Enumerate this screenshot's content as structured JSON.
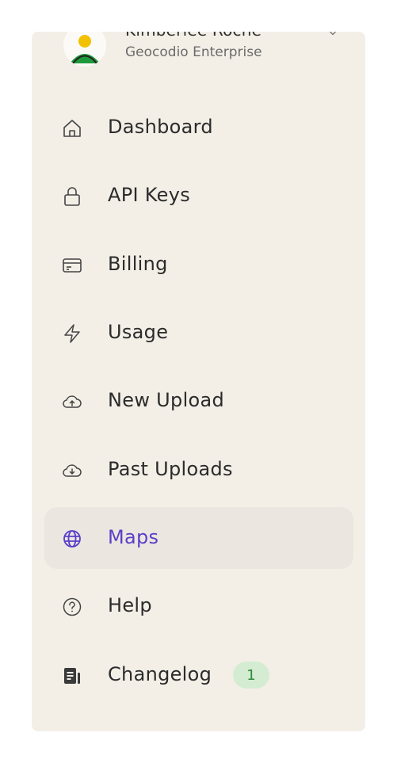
{
  "account": {
    "name": "Kimberlee Roche",
    "plan": "Geocodio Enterprise"
  },
  "colors": {
    "panel_bg": "#f3efe7",
    "active_bg": "#ebe6e0",
    "active_text": "#5b3fc8",
    "badge_bg": "#d4ecd2",
    "badge_text": "#2f8a3a"
  },
  "nav": {
    "items": [
      {
        "label": "Dashboard",
        "icon": "home-icon"
      },
      {
        "label": "API Keys",
        "icon": "lock-icon"
      },
      {
        "label": "Billing",
        "icon": "credit-card-icon"
      },
      {
        "label": "Usage",
        "icon": "lightning-icon"
      },
      {
        "label": "New Upload",
        "icon": "cloud-upload-icon"
      },
      {
        "label": "Past Uploads",
        "icon": "cloud-download-icon"
      },
      {
        "label": "Maps",
        "icon": "globe-icon",
        "active": true
      },
      {
        "label": "Help",
        "icon": "help-circle-icon"
      },
      {
        "label": "Changelog",
        "icon": "changelog-icon",
        "badge": "1"
      }
    ]
  }
}
